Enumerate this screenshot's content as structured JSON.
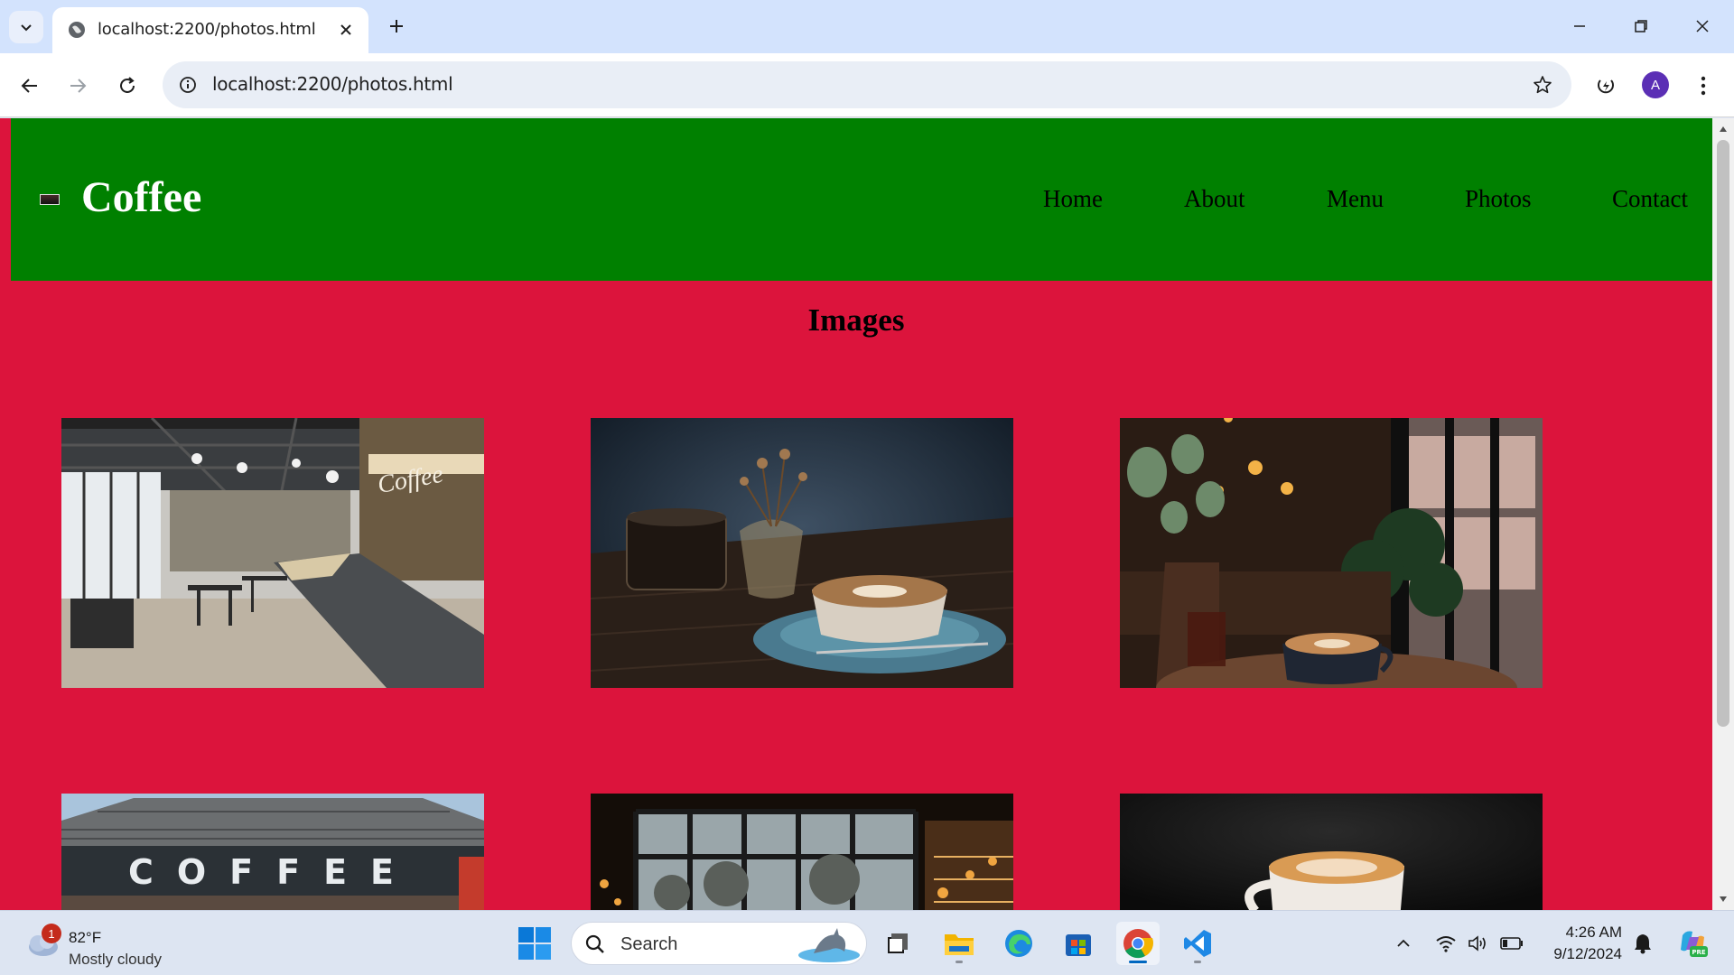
{
  "browser": {
    "tab_title": "localhost:2200/photos.html",
    "url": "localhost:2200/photos.html",
    "profile_initial": "A"
  },
  "site": {
    "brand": "Coffee",
    "nav": [
      "Home",
      "About",
      "Menu",
      "Photos",
      "Contact"
    ],
    "section_title": "Images",
    "colors": {
      "header_bg": "#008000",
      "page_bg": "#dc143c"
    },
    "photos": [
      {
        "name": "photo-cafe-interior"
      },
      {
        "name": "photo-coffee-on-table"
      },
      {
        "name": "photo-coffee-by-window"
      },
      {
        "name": "photo-coffee-storefront",
        "sign_text": "COFFEE"
      },
      {
        "name": "photo-cafe-night-windows"
      },
      {
        "name": "photo-latte-dark"
      }
    ]
  },
  "taskbar": {
    "weather_temp": "82°F",
    "weather_desc": "Mostly cloudy",
    "weather_badge": "1",
    "search_label": "Search",
    "time": "4:26 AM",
    "date": "9/12/2024"
  }
}
